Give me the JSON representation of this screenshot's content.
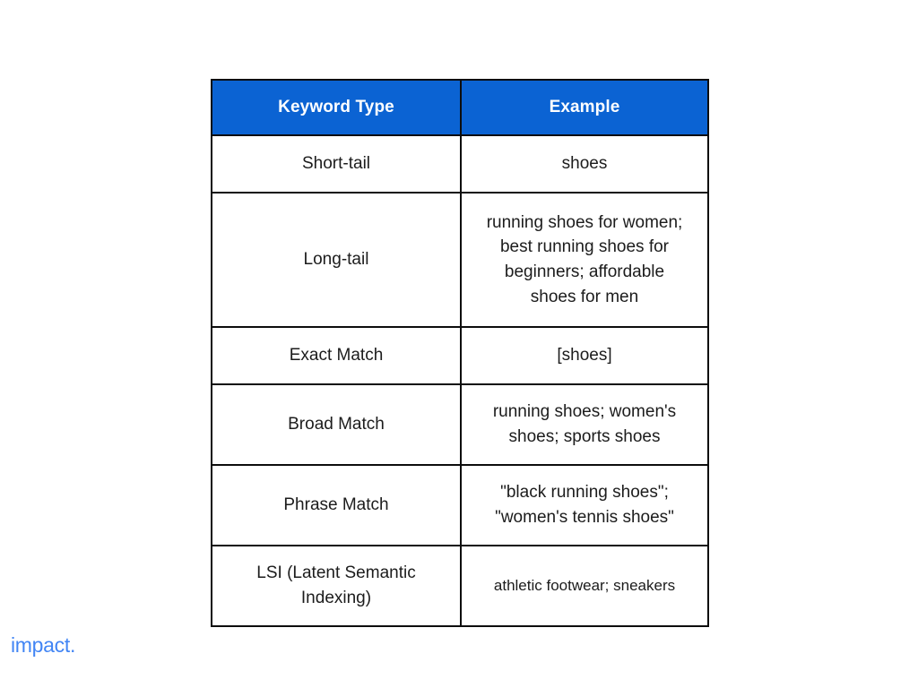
{
  "slide": {
    "background_color": "#ffffff",
    "accent_color": "#0B63D3",
    "border_color": "#0d0d0d",
    "text_color": "#1c1c1c"
  },
  "logo": {
    "text": "impact.",
    "color": "#4285F4"
  },
  "table": {
    "columns": [
      {
        "id": "keyword-type",
        "header": "Keyword Type"
      },
      {
        "id": "example",
        "header": "Example"
      }
    ],
    "rows": [
      {
        "id": "short-tail",
        "keyword_type": "Short-tail",
        "example": "shoes"
      },
      {
        "id": "long-tail",
        "keyword_type": "Long-tail",
        "example": "running shoes for women; best running shoes for beginners; affordable shoes for men"
      },
      {
        "id": "exact-match",
        "keyword_type": "Exact Match",
        "example": "[shoes]"
      },
      {
        "id": "broad-match",
        "keyword_type": "Broad Match",
        "example": "running shoes; women's shoes; sports shoes"
      },
      {
        "id": "phrase-match",
        "keyword_type": "Phrase Match",
        "example": "\"black running shoes\"; \"women's tennis shoes\""
      },
      {
        "id": "lsi",
        "keyword_type": "LSI (Latent Semantic Indexing)",
        "example": "athletic footwear; sneakers"
      }
    ]
  }
}
